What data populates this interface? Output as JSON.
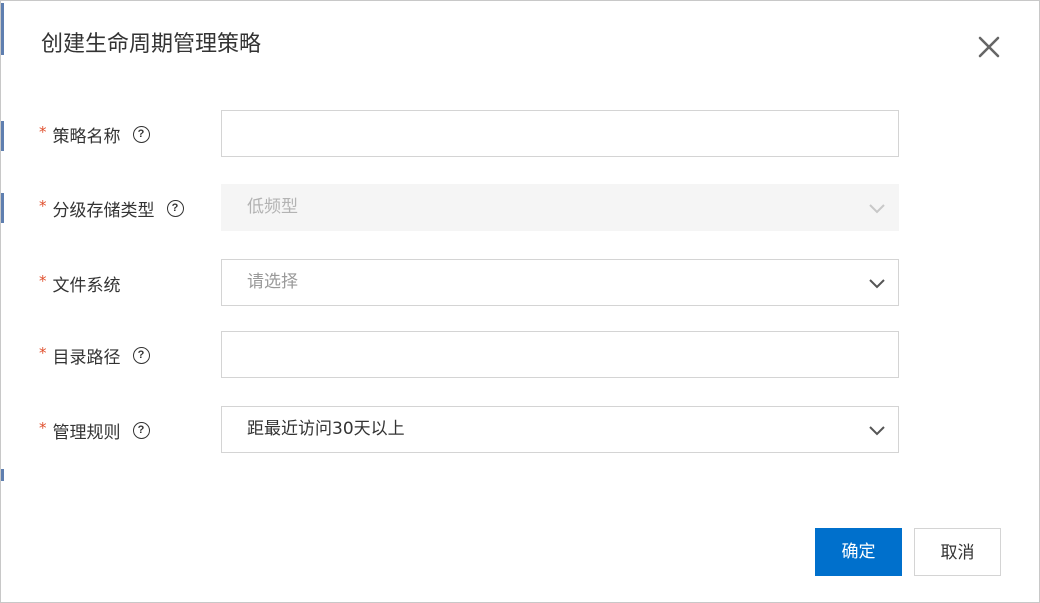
{
  "dialog": {
    "title": "创建生命周期管理策略",
    "close_icon": "close-icon"
  },
  "form": {
    "required_mark": "*",
    "help_glyph": "?",
    "policy_name": {
      "label": "策略名称",
      "value": ""
    },
    "storage_type": {
      "label": "分级存储类型",
      "value": "低频型",
      "disabled": true
    },
    "file_system": {
      "label": "文件系统",
      "placeholder": "请选择"
    },
    "directory_path": {
      "label": "目录路径",
      "value": ""
    },
    "management_rule": {
      "label": "管理规则",
      "value": "距最近访问30天以上"
    }
  },
  "footer": {
    "confirm_label": "确定",
    "cancel_label": "取消"
  },
  "colors": {
    "primary": "#0070cc",
    "required": "#e0502e",
    "border": "#d4d4d4",
    "disabled_bg": "#f5f5f5"
  }
}
